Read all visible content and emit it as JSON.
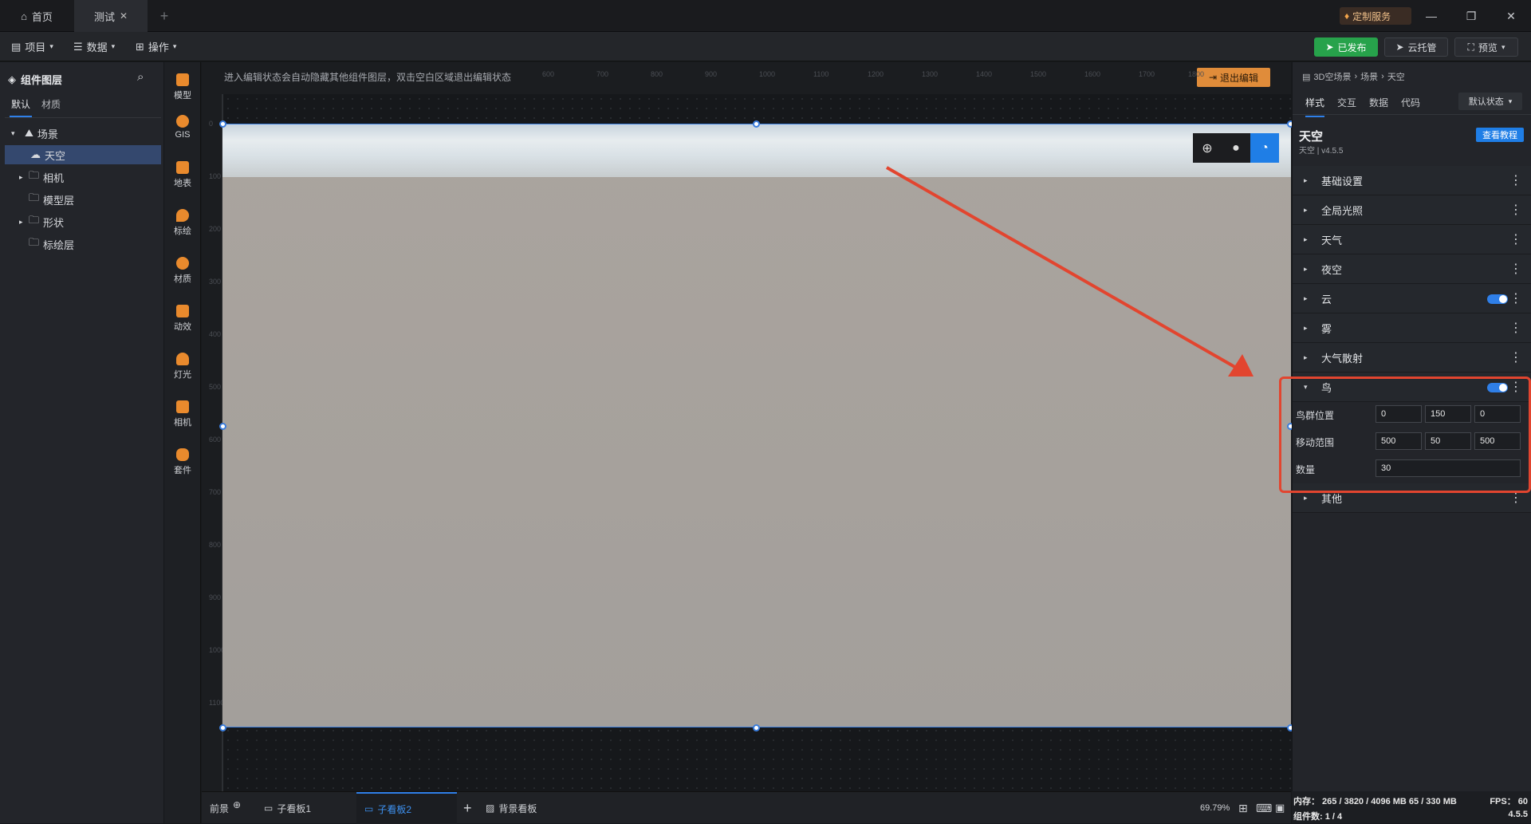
{
  "titlebar": {
    "tabs": [
      {
        "label": "首页",
        "icon": "home-icon"
      },
      {
        "label": "测试",
        "icon": "close-icon"
      }
    ],
    "custom_service": "定制服务"
  },
  "toolbar": {
    "menus": [
      "项目",
      "数据",
      "操作"
    ],
    "publish": "已发布",
    "cloud": "云托管",
    "preview": "预览"
  },
  "left_panel": {
    "title": "组件图层",
    "tabs": [
      "默认",
      "材质"
    ],
    "tree": [
      {
        "label": "场景",
        "level": 0,
        "expanded": true
      },
      {
        "label": "天空",
        "level": 1,
        "selected": true
      },
      {
        "label": "相机",
        "level": 1,
        "expandable": true
      },
      {
        "label": "模型层",
        "level": 1
      },
      {
        "label": "形状",
        "level": 1,
        "expandable": true
      },
      {
        "label": "标绘层",
        "level": 1
      }
    ]
  },
  "icon_bar": [
    "模型",
    "GIS",
    "地表",
    "标绘",
    "材质",
    "动效",
    "灯光",
    "相机",
    "套件"
  ],
  "canvas": {
    "hint": "进入编辑状态会自动隐藏其他组件图层，双击空白区域退出编辑状态",
    "exit_edit": "退出编辑",
    "ruler_top": [
      "600",
      "700",
      "800",
      "900",
      "1000",
      "1100",
      "1200",
      "1300",
      "1400",
      "1500",
      "1600",
      "1700",
      "1800"
    ],
    "ruler_left": [
      "0",
      "100",
      "200",
      "300",
      "400",
      "500",
      "600",
      "700",
      "800",
      "900",
      "1000",
      "1100"
    ]
  },
  "bottom_bar": {
    "tabs": [
      "前景",
      "子看板1",
      "子看板2",
      "背景看板"
    ],
    "active_tab": "子看板2",
    "zoom": "69.79%"
  },
  "right_panel": {
    "breadcrumb": [
      "3D空场景",
      "场景",
      "天空"
    ],
    "tabs": [
      "样式",
      "交互",
      "数据",
      "代码"
    ],
    "state_select": "默认状态",
    "component_title": "天空",
    "component_sub": "天空 | v4.5.5",
    "tutorial": "查看教程",
    "sections": [
      {
        "label": "基础设置",
        "expanded": false,
        "toggle": false
      },
      {
        "label": "全局光照",
        "expanded": false,
        "toggle": false
      },
      {
        "label": "天气",
        "expanded": false,
        "toggle": false
      },
      {
        "label": "夜空",
        "expanded": false,
        "toggle": false
      },
      {
        "label": "云",
        "expanded": false,
        "toggle": true
      },
      {
        "label": "雾",
        "expanded": false,
        "toggle": false
      },
      {
        "label": "大气散射",
        "expanded": false,
        "toggle": false
      },
      {
        "label": "鸟",
        "expanded": true,
        "toggle": true
      }
    ],
    "bird": {
      "position_label": "鸟群位置",
      "position": [
        "0",
        "150",
        "0"
      ],
      "range_label": "移动范围",
      "range": [
        "500",
        "50",
        "500"
      ],
      "count_label": "数量",
      "count": "30"
    },
    "other_section": "其他"
  },
  "status": {
    "memory": "内存： 265 / 3820 / 4096 MB  65 / 330 MB",
    "fps": "FPS： 60",
    "components": "组件数: 1 / 4",
    "version": "4.5.5"
  },
  "colors": {
    "accent": "#2f7fe8",
    "annotation": "#e2452f",
    "publish": "#27a24b",
    "exit_edit": "#e08c3a"
  }
}
